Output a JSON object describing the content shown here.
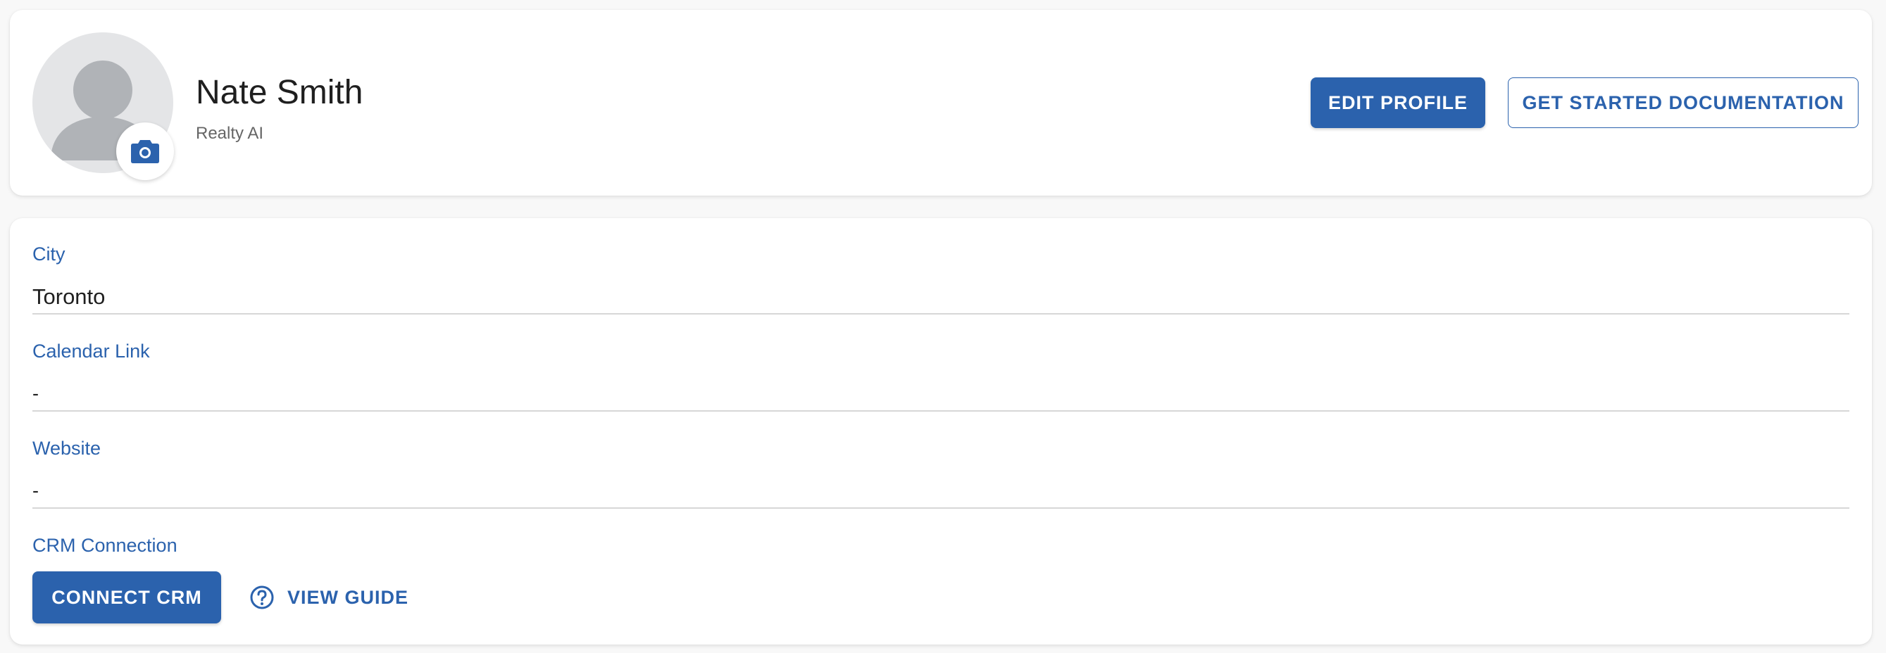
{
  "colors": {
    "accent": "#2b62ad",
    "label": "#2b62ad",
    "text": "#1f1f1f",
    "muted": "#666666",
    "divider": "#d7d7d7"
  },
  "profile": {
    "avatar_icon": "person-placeholder-icon",
    "camera_icon": "camera-icon",
    "name": "Nate Smith",
    "company": "Realty AI",
    "edit_label": "EDIT PROFILE",
    "docs_label": "GET STARTED DOCUMENTATION"
  },
  "details": {
    "city": {
      "label": "City",
      "value": "Toronto"
    },
    "calendar": {
      "label": "Calendar Link",
      "value": "-"
    },
    "website": {
      "label": "Website",
      "value": "-"
    },
    "crm": {
      "label": "CRM Connection",
      "connect_label": "CONNECT CRM",
      "guide_label": "VIEW GUIDE",
      "guide_icon": "help-circle-icon"
    }
  }
}
